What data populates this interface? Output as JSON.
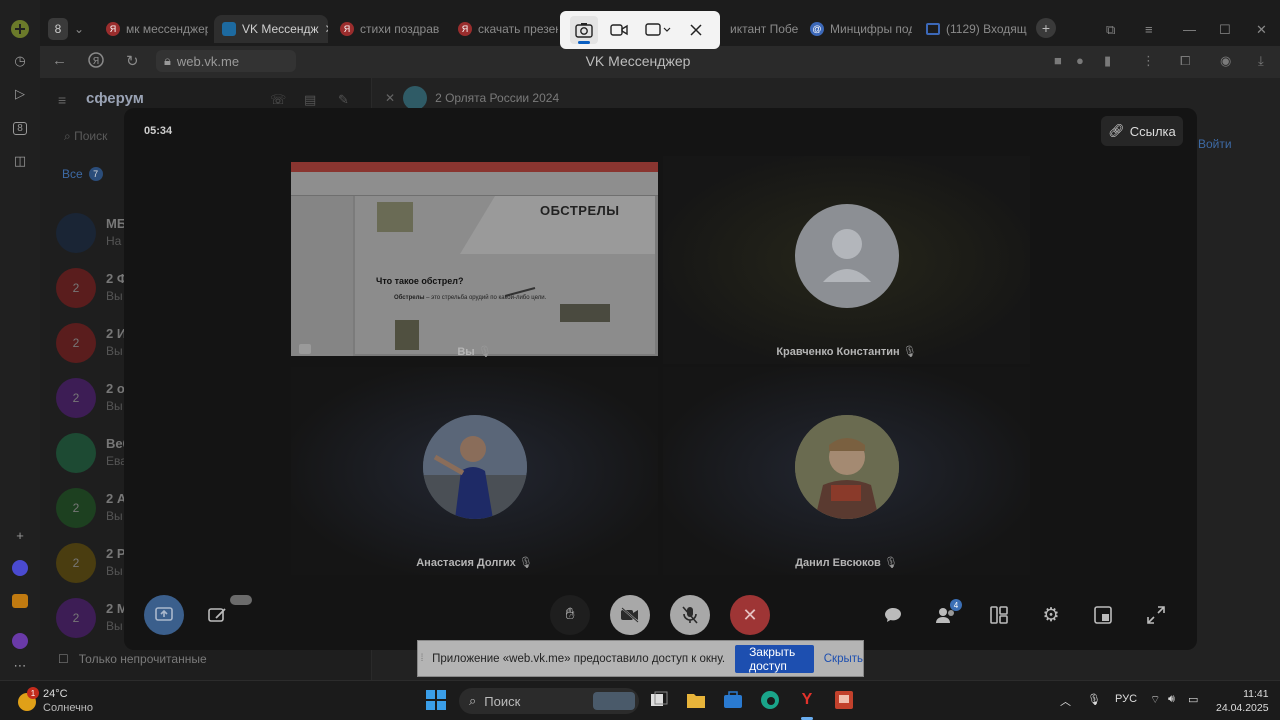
{
  "tabs": [
    {
      "label": "мк мессенджер",
      "icon": "yandex-icon"
    },
    {
      "label": "VK Мессендж",
      "icon": "vk-icon"
    },
    {
      "label": "стихи поздрав",
      "icon": "yandex-icon"
    },
    {
      "label": "скачать презен",
      "icon": "yandex-icon"
    },
    {
      "label": "иктант Побе",
      "icon": "page-icon"
    },
    {
      "label": "Минцифры под",
      "icon": "at-icon"
    },
    {
      "label": "(1129) Входящ",
      "icon": "mail-icon"
    }
  ],
  "tab_counter": "8",
  "address": {
    "url": "web.vk.me",
    "page_title": "VK Мессенджер"
  },
  "sidebar": {
    "brand": "сферум",
    "search_placeholder": "Поиск",
    "filter_label": "Все",
    "filter_count": "7",
    "chats": [
      {
        "name": "МБ",
        "preview": "На",
        "avatar": "",
        "color": "#1a2535"
      },
      {
        "name": "2 Ф",
        "preview": "Вы",
        "avatar": "2",
        "color": "#5a1d1d"
      },
      {
        "name": "2 И",
        "preview": "Вы",
        "avatar": "2",
        "color": "#5a1d1d"
      },
      {
        "name": "2 о",
        "preview": "Вы",
        "avatar": "2",
        "color": "#3d1d55"
      },
      {
        "name": "Веб",
        "preview": "Ева",
        "avatar": "",
        "color": "#1d4a33"
      },
      {
        "name": "2 А",
        "preview": "Вы",
        "avatar": "2",
        "color": "#1d4020"
      },
      {
        "name": "2 Р",
        "preview": "Вы",
        "avatar": "2",
        "color": "#4a3d10"
      },
      {
        "name": "2 М",
        "preview": "Вы",
        "avatar": "2",
        "color": "#3d1d55"
      }
    ],
    "only_unread": "Только непрочитанные"
  },
  "conversation": {
    "title": "2 Орлята России 2024",
    "join_label": "Войти"
  },
  "call": {
    "timer": "05:34",
    "link_label": "Ссылка",
    "participants": [
      {
        "name": "Вы",
        "muted": true
      },
      {
        "name": "Кравченко Константин",
        "muted": true
      },
      {
        "name": "Анастасия Долгих",
        "muted": true
      },
      {
        "name": "Данил Евсюков",
        "muted": true
      }
    ],
    "slide": {
      "title": "ОБСТРЕЛЫ",
      "question": "Что такое обстрел?",
      "text_bold": "Обстрелы",
      "text": " – это стрельба орудий по какой-либо цели."
    },
    "participants_count": "4"
  },
  "share_notice": {
    "message": "Приложение «web.vk.me» предоставило доступ к окну.",
    "stop_label": "Закрыть доступ",
    "hide_label": "Скрыть"
  },
  "taskbar": {
    "temperature": "24°C",
    "weather": "Солнечно",
    "weather_badge": "1",
    "search_placeholder": "Поиск",
    "language": "РУС",
    "time": "11:41",
    "date": "24.04.2025"
  }
}
